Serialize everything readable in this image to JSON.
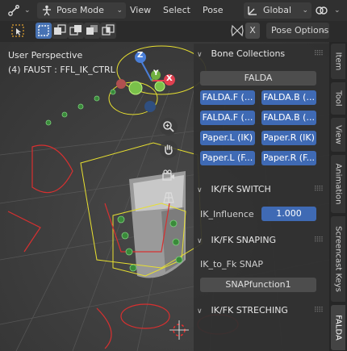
{
  "header": {
    "mode": "Pose Mode",
    "menus": [
      "View",
      "Select",
      "Pose"
    ],
    "orientation": "Global"
  },
  "toolbar": {
    "x_toggle": "X",
    "pose_options": "Pose Options"
  },
  "viewport": {
    "perspective": "User Perspective",
    "object_info": "(4) FAUST : FFL_IK_CTRL",
    "gizmo": {
      "z": "Z",
      "y": "Y",
      "x": "X"
    }
  },
  "panel": {
    "bone_collections": {
      "title": "Bone Collections",
      "falda": "FALDA",
      "buttons": [
        "FALDA.F (...",
        "FALDA.B (...",
        "FALDA.F (...",
        "FALDA.B (...",
        "Paper.L (IK)",
        "Paper.R (IK)",
        "Paper.L (F...",
        "Paper.R (F..."
      ]
    },
    "ikfk_switch": {
      "title": "IK/FK SWITCH",
      "label": "IK_Influence",
      "value": "1.000"
    },
    "ikfk_snaping": {
      "title": "IK/FK SNAPING",
      "label": "IK_to_Fk SNAP",
      "button": "SNAPfunction1"
    },
    "ikfk_streching": {
      "title": "IK/FK STRECHING"
    }
  },
  "side_tabs": [
    "Item",
    "Tool",
    "View",
    "Animation",
    "Screencast Keys",
    "FALDA"
  ],
  "colors": {
    "accent": "#3f6ab4",
    "background": "#2b2b2b",
    "panel": "#303030"
  }
}
